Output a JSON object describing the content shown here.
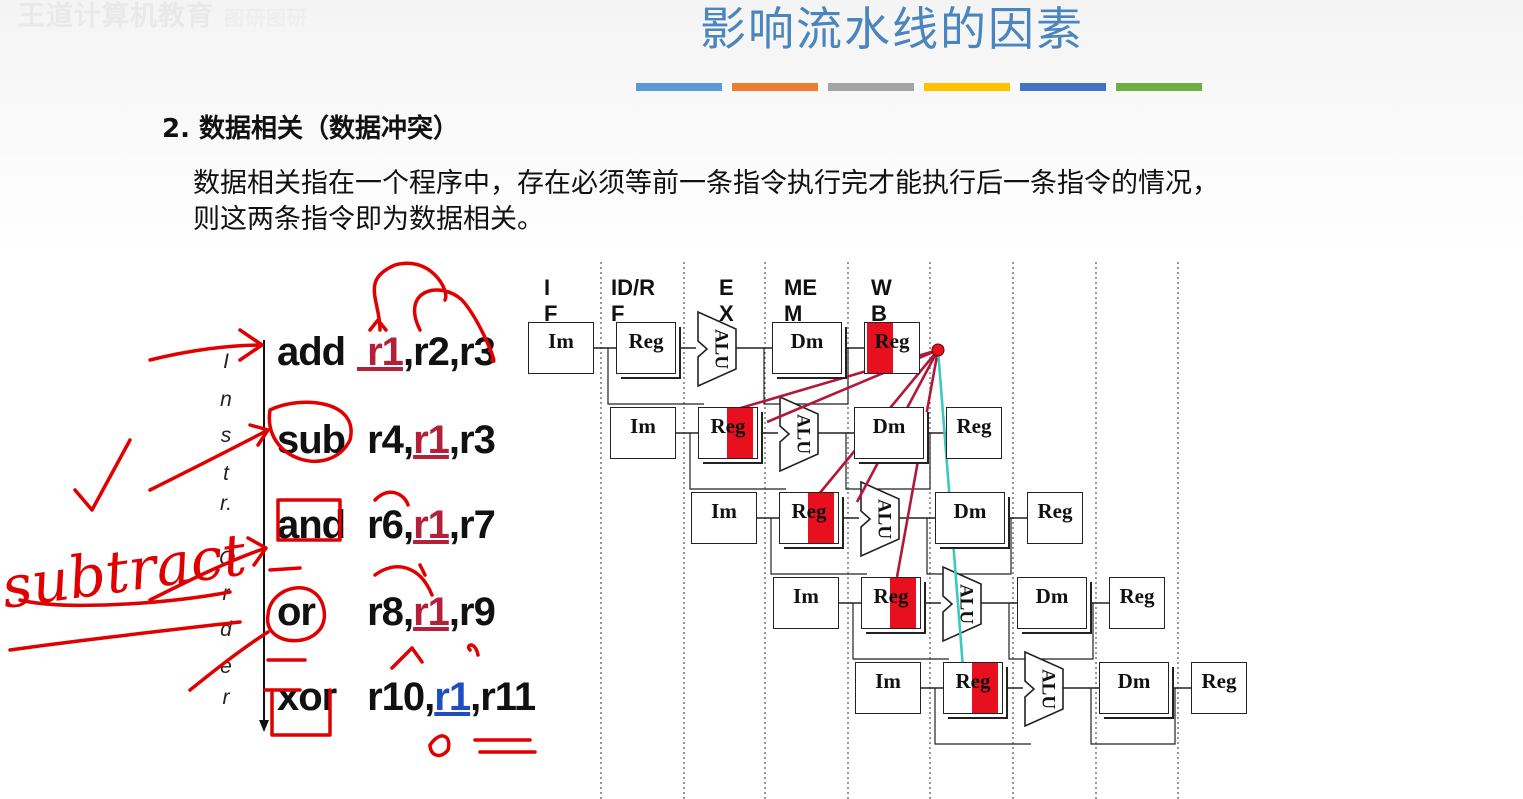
{
  "header": {
    "watermark": "王道计算机教育",
    "watermark_sub": "图研图研",
    "title": "影响流水线的因素",
    "bar_colors": [
      "#5b9bd5",
      "#ed7d31",
      "#a5a5a5",
      "#ffc000",
      "#4472c4",
      "#70ad47"
    ]
  },
  "section": {
    "heading": "2. 数据相关（数据冲突）",
    "definition": "数据相关指在一个程序中，存在必须等前一条指令执行完才能执行后一条指令的情况，\n则这两条指令即为数据相关。"
  },
  "diagram": {
    "stages": [
      {
        "id": "if",
        "label": "I\nF"
      },
      {
        "id": "id",
        "label": "ID/R\nF"
      },
      {
        "id": "ex",
        "label": "E\nX"
      },
      {
        "id": "mem",
        "label": "ME\nM"
      },
      {
        "id": "wb",
        "label": "W\nB"
      }
    ],
    "axis_label": "Instr. Order",
    "axis_letters": [
      "I",
      "n",
      "s",
      "t",
      "r.",
      "O",
      "r",
      "d",
      "e",
      "r"
    ],
    "instructions": [
      {
        "op": "add",
        "dest": "r1",
        "sep1": ",",
        "src1": "r2",
        "sep2": ",",
        "src2": "r3"
      },
      {
        "op": "sub",
        "dest": "r4",
        "sep1": ",",
        "src1": "r1",
        "sep2": ",",
        "src2": "r3"
      },
      {
        "op": "and",
        "dest": "r6",
        "sep1": ",",
        "src1": "r1",
        "sep2": ",",
        "src2": "r7"
      },
      {
        "op": "or",
        "dest": "r8",
        "sep1": ",",
        "src1": "r1",
        "sep2": ",",
        "src2": "r9"
      },
      {
        "op": "xor",
        "dest": "r10",
        "sep1": ",",
        "src1": "r1",
        "sep2": ",",
        "src2": "r11"
      }
    ],
    "blocks": {
      "im": "Im",
      "reg": "Reg",
      "alu": "ALU",
      "dm": "Dm"
    },
    "colors": {
      "hazard_fill": "#e8101e",
      "hazard_line": "#b0193a",
      "forward_line": "#3cc8c0",
      "ink": "#e00000"
    }
  },
  "annotation": {
    "handwritten": "subtract"
  }
}
